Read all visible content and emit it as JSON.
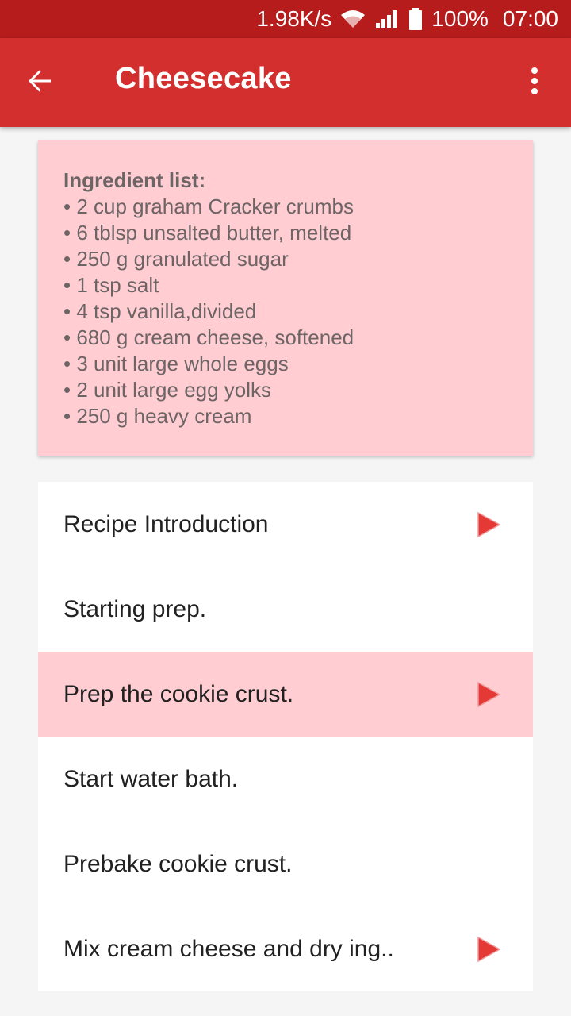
{
  "status_bar": {
    "network_speed": "1.98K/s",
    "battery": "100%",
    "time": "07:00",
    "icons": [
      "wifi-icon",
      "signal-icon",
      "battery-icon"
    ]
  },
  "app_bar": {
    "title": "Cheesecake",
    "back_icon": "arrow-back-icon",
    "menu_icon": "more-vert-icon",
    "color": "#d32f2f",
    "status_color": "#b71c1c"
  },
  "ingredients": {
    "title": "Ingredient list:",
    "items": [
      "• 2 cup graham Cracker crumbs",
      "• 6 tblsp unsalted butter, melted",
      "• 250 g granulated sugar",
      "• 1 tsp salt",
      "• 4 tsp vanilla,divided",
      "• 680 g cream cheese, softened",
      "• 3 unit large whole eggs",
      "• 2 unit large egg yolks",
      "• 250 g heavy cream"
    ],
    "background": "#ffcdd2"
  },
  "steps": [
    {
      "label": "Recipe Introduction",
      "has_video": true,
      "selected": false
    },
    {
      "label": "Starting prep.",
      "has_video": false,
      "selected": false
    },
    {
      "label": "Prep the cookie crust.",
      "has_video": true,
      "selected": true
    },
    {
      "label": "Start water bath.",
      "has_video": false,
      "selected": false
    },
    {
      "label": "Prebake cookie crust.",
      "has_video": false,
      "selected": false
    },
    {
      "label": "Mix cream cheese and dry ing..",
      "has_video": true,
      "selected": false
    }
  ],
  "accent": "#e53935"
}
